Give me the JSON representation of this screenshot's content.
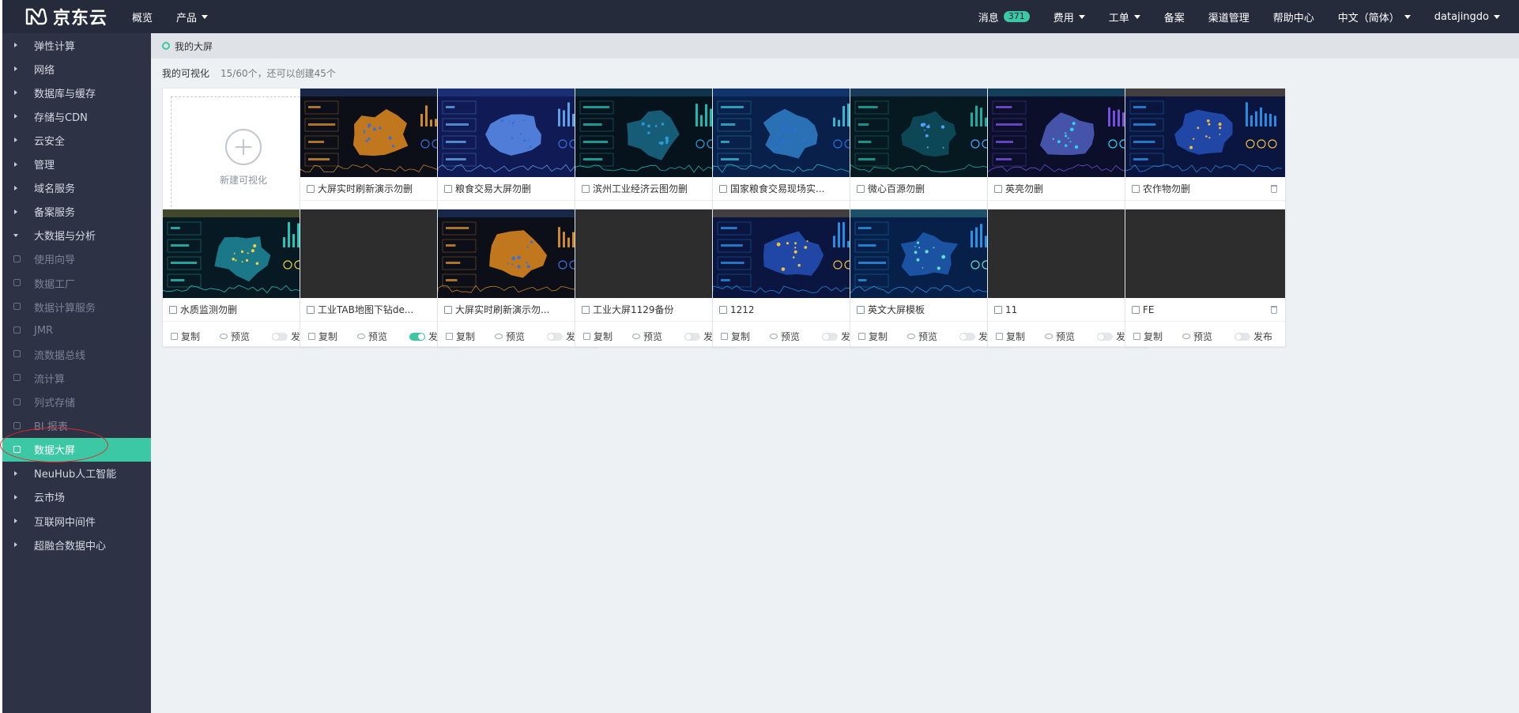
{
  "colors": {
    "topbar": "#262b3c",
    "sidebar": "#2d3245",
    "accent": "#3cc8a4",
    "content_bg": "#eef1f4",
    "annotation": "#d92b2b"
  },
  "header": {
    "logo_text": "京东云",
    "nav_left": [
      {
        "label": "概览",
        "dropdown": false
      },
      {
        "label": "产品",
        "dropdown": true
      }
    ],
    "messages": {
      "label": "消息",
      "count": "371"
    },
    "nav_right": [
      {
        "label": "费用",
        "dropdown": true
      },
      {
        "label": "工单",
        "dropdown": true
      },
      {
        "label": "备案",
        "dropdown": false
      },
      {
        "label": "渠道管理",
        "dropdown": false
      },
      {
        "label": "帮助中心",
        "dropdown": false
      },
      {
        "label": "中文（简体）",
        "dropdown": true
      },
      {
        "label": "datajingdo",
        "dropdown": true
      }
    ]
  },
  "sidebar": {
    "items": [
      {
        "label": "弹性计算",
        "type": "group"
      },
      {
        "label": "网络",
        "type": "group"
      },
      {
        "label": "数据库与缓存",
        "type": "group"
      },
      {
        "label": "存储与CDN",
        "type": "group"
      },
      {
        "label": "云安全",
        "type": "group"
      },
      {
        "label": "管理",
        "type": "group"
      },
      {
        "label": "域名服务",
        "type": "group"
      },
      {
        "label": "备案服务",
        "type": "group"
      },
      {
        "label": "大数据与分析",
        "type": "group-open"
      },
      {
        "label": "使用向导",
        "type": "sub"
      },
      {
        "label": "数据工厂",
        "type": "sub"
      },
      {
        "label": "数据计算服务",
        "type": "sub"
      },
      {
        "label": "JMR",
        "type": "sub"
      },
      {
        "label": "流数据总线",
        "type": "sub"
      },
      {
        "label": "流计算",
        "type": "sub"
      },
      {
        "label": "列式存储",
        "type": "sub"
      },
      {
        "label": "BI 报表",
        "type": "sub"
      },
      {
        "label": "数据大屏",
        "type": "sub-active"
      },
      {
        "label": "NeuHub人工智能",
        "type": "group"
      },
      {
        "label": "云市场",
        "type": "group"
      },
      {
        "label": "互联网中间件",
        "type": "group"
      },
      {
        "label": "超融合数据中心",
        "type": "group"
      }
    ]
  },
  "breadcrumb": {
    "label": "我的大屏"
  },
  "quota": {
    "title": "我的可视化",
    "count": "15/60个，还可以创建45个"
  },
  "new_card": {
    "label": "新建可视化"
  },
  "actions": {
    "copy": "复制",
    "preview": "预览",
    "publish": "发布"
  },
  "cards": [
    {
      "name": "大屏实时刷新演示勿删",
      "published": false,
      "thumb": "dark-map-orange"
    },
    {
      "name": "粮食交易大屏勿删",
      "published": false,
      "thumb": "blue-map"
    },
    {
      "name": "滨州工业经济云图勿删",
      "published": true,
      "thumb": "teal-bars"
    },
    {
      "name": "国家粮食交易现场实...",
      "published": false,
      "thumb": "blue-map-dense"
    },
    {
      "name": "微心百源勿删",
      "published": false,
      "thumb": "teal-grid"
    },
    {
      "name": "英亮勿删",
      "published": true,
      "thumb": "purple-bars"
    },
    {
      "name": "农作物勿删",
      "published": false,
      "thumb": "blue-province"
    },
    {
      "name": "水质监测勿删",
      "published": false,
      "thumb": "teal-map"
    },
    {
      "name": "工业TAB地图下钻de...",
      "published": true,
      "thumb": "empty"
    },
    {
      "name": "大屏实时刷新演示勿...",
      "published": false,
      "thumb": "dark-map-orange"
    },
    {
      "name": "工业大屏1129备份",
      "published": false,
      "thumb": "empty"
    },
    {
      "name": "1212",
      "published": false,
      "thumb": "blue-province"
    },
    {
      "name": "英文大屏模板",
      "published": false,
      "thumb": "world-map"
    },
    {
      "name": "11",
      "published": false,
      "thumb": "empty"
    },
    {
      "name": "FE",
      "published": false,
      "thumb": "empty"
    }
  ]
}
